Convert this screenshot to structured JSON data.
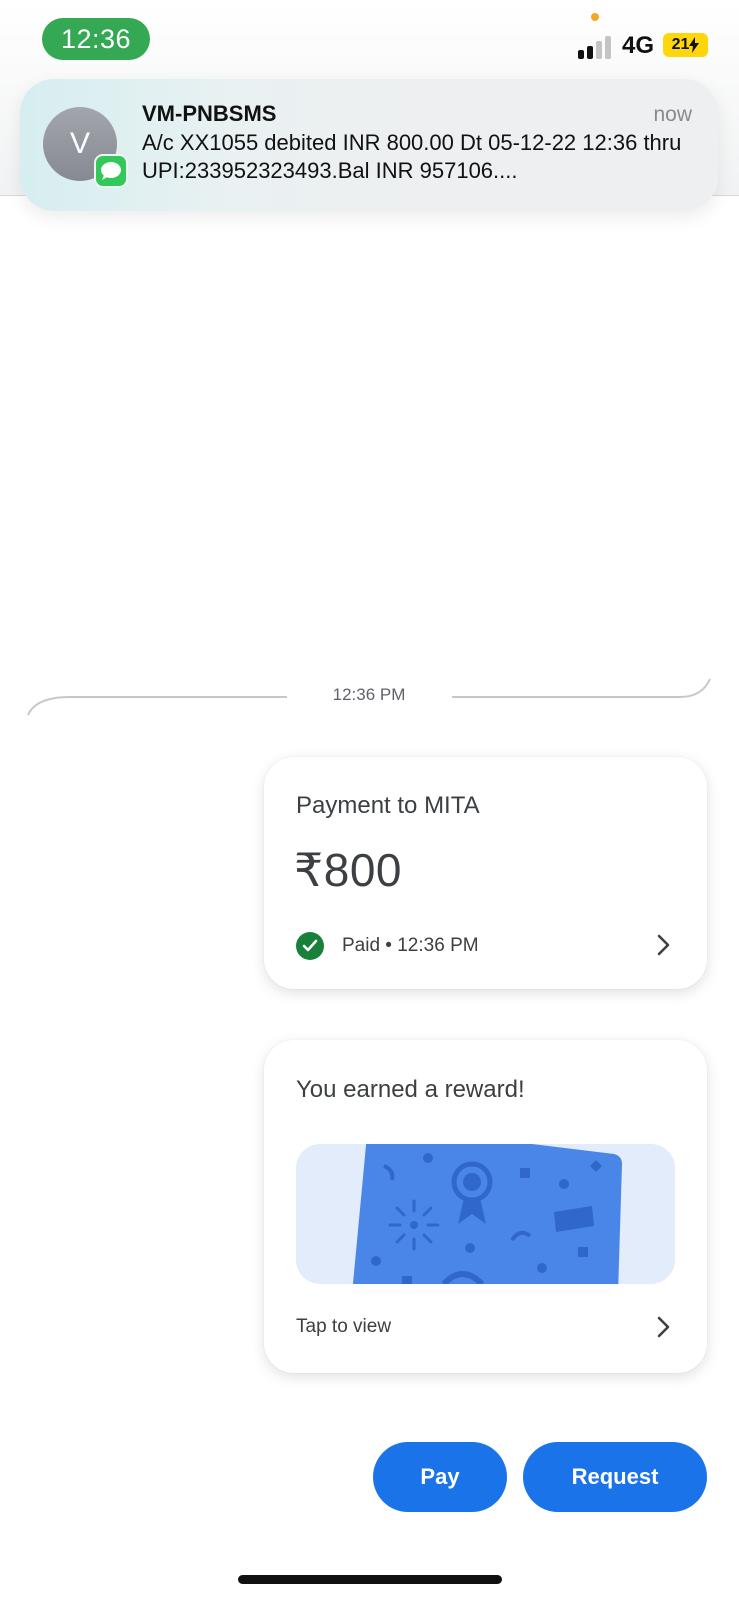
{
  "status_bar": {
    "time": "12:36",
    "network": "4G",
    "battery": "21"
  },
  "notification": {
    "avatar_initial": "V",
    "sender": "VM-PNBSMS",
    "time": "now",
    "message": "A/c XX1055 debited INR 800.00 Dt 05-12-22 12:36 thru UPI:233952323493.Bal INR 957106....",
    "app_icon": "messages-icon"
  },
  "chat": {
    "timestamp": "12:36 PM"
  },
  "payment_card": {
    "title": "Payment to MITA",
    "amount": "₹800",
    "status": "Paid • 12:36 PM",
    "status_icon": "check-circle-icon",
    "status_color": "#188038"
  },
  "reward_card": {
    "title": "You earned a reward!",
    "action": "Tap to view"
  },
  "actions": {
    "pay_label": "Pay",
    "request_label": "Request"
  },
  "colors": {
    "accent": "#1a73e8",
    "status_time_pill": "#34a853",
    "battery": "#ffd60a",
    "reward_card": "#4a86e8"
  }
}
